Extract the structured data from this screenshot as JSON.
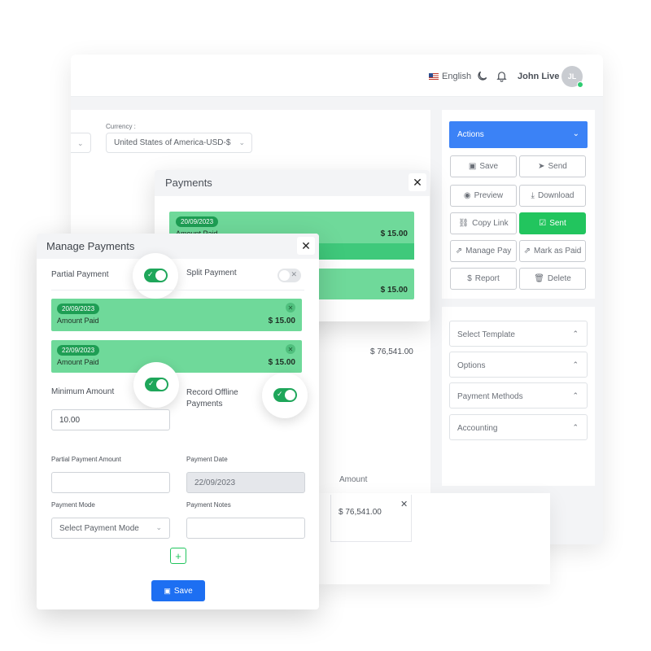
{
  "header": {
    "language": "English",
    "user_name": "John Live",
    "avatar_initials": "JL"
  },
  "invoice_form": {
    "currency_label": "Currency :",
    "currency_value": "United States of America-USD-$",
    "total_value": "$ 76,541.00",
    "amount_header": "Amount",
    "row_amount": "$ 76,541.00"
  },
  "actions": {
    "header": "Actions",
    "buttons": [
      {
        "label": "Save",
        "icon": "save-icon"
      },
      {
        "label": "Send",
        "icon": "send-icon"
      },
      {
        "label": "Preview",
        "icon": "eye-icon"
      },
      {
        "label": "Download",
        "icon": "download-icon"
      },
      {
        "label": "Copy Link",
        "icon": "link-icon"
      },
      {
        "label": "Sent",
        "icon": "check-square-icon"
      },
      {
        "label": "Manage Pay",
        "icon": "external-link-icon"
      },
      {
        "label": "Mark as Paid",
        "icon": "external-link-icon"
      },
      {
        "label": "Report",
        "icon": "dollar-icon"
      },
      {
        "label": "Delete",
        "icon": "trash-icon"
      }
    ],
    "accordions": [
      "Select Template",
      "Options",
      "Payment Methods",
      "Accounting"
    ]
  },
  "payments_modal": {
    "title": "Payments",
    "cards": [
      {
        "date": "20/09/2023",
        "label": "Amount Paid",
        "amount": "$ 15.00"
      },
      {
        "amount": "$ 15.00"
      }
    ]
  },
  "manage_payments": {
    "title": "Manage Payments",
    "partial_payment_label": "Partial Payment",
    "partial_payment_on": true,
    "split_payment_label": "Split Payment",
    "split_payment_on": false,
    "payments": [
      {
        "date": "20/09/2023",
        "label": "Amount Paid",
        "amount": "$ 15.00"
      },
      {
        "date": "22/09/2023",
        "label": "Amount Paid",
        "amount": "$ 15.00"
      }
    ],
    "minimum_amount_label": "Minimum Amount",
    "minimum_amount_on": true,
    "minimum_amount_value": "10.00",
    "record_offline_label": "Record Offline Payments",
    "record_offline_on": true,
    "partial_amount_label": "Partial Payment Amount",
    "partial_amount_value": "",
    "payment_date_label": "Payment Date",
    "payment_date_value": "22/09/2023",
    "payment_mode_label": "Payment Mode",
    "payment_mode_placeholder": "Select Payment Mode",
    "payment_notes_label": "Payment Notes",
    "payment_notes_value": "",
    "save_label": "Save"
  },
  "colors": {
    "primary": "#1d6ff2",
    "actions_header": "#3b82f6",
    "success": "#22c55e",
    "payment_card": "#6fd99a",
    "toggle_on": "#1ea65a"
  }
}
